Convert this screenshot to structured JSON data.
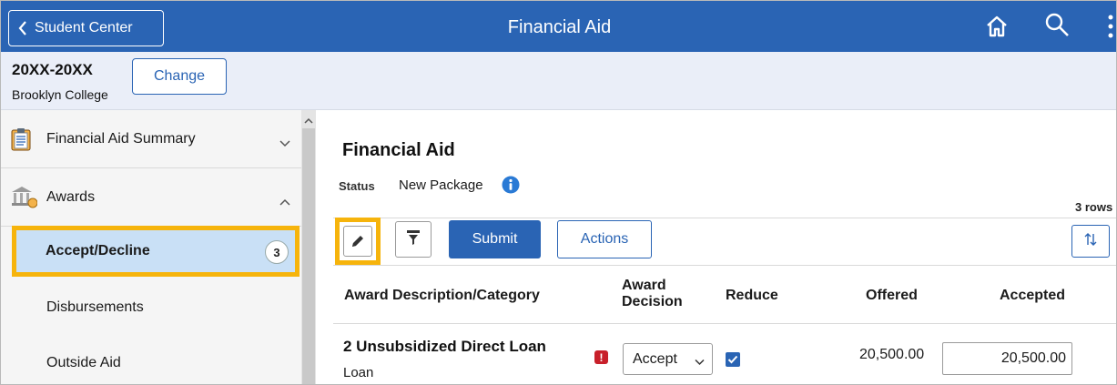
{
  "header": {
    "back_label": "Student Center",
    "title": "Financial Aid"
  },
  "career": {
    "term": "20XX-20XX",
    "school": "Brooklyn College",
    "change_label": "Change"
  },
  "sidebar": {
    "items": [
      {
        "label": "Financial Aid Summary",
        "icon": "clipboard-icon",
        "expanded": false
      },
      {
        "label": "Awards",
        "icon": "bank-icon",
        "expanded": true
      }
    ],
    "sub_items": [
      {
        "label": "Accept/Decline",
        "count": "3",
        "active": true
      },
      {
        "label": "Disbursements"
      },
      {
        "label": "Outside Aid"
      }
    ]
  },
  "main": {
    "title": "Financial Aid",
    "status_label": "Status",
    "status_value": "New Package",
    "rows_count": "3 rows",
    "submit_label": "Submit",
    "actions_label": "Actions",
    "columns": [
      "Award Description/Category",
      "Award\nDecision",
      "Reduce",
      "Offered",
      "Accepted"
    ],
    "rows": [
      {
        "name": "2 Unsubsidized Direct Loan",
        "category": "Loan",
        "decision": "Accept",
        "reduce": true,
        "offered": "20,500.00",
        "accepted": "20,500.00"
      }
    ]
  },
  "colors": {
    "brand": "#2a64b4",
    "highlight": "#f6b40c",
    "active_bg": "#c9e0f6",
    "warning": "#c8202a"
  }
}
